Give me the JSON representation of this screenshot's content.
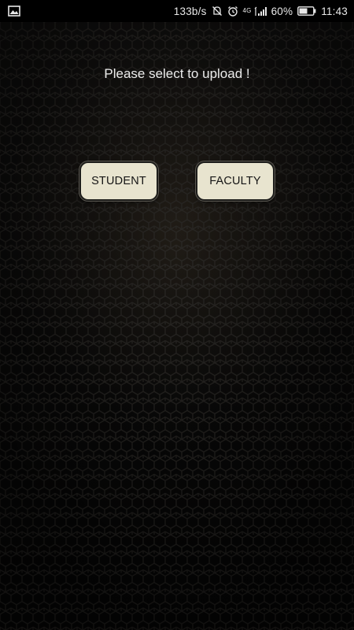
{
  "status_bar": {
    "network_speed": "133b/s",
    "network_type": "4G",
    "battery_percent": "60%",
    "time": "11:43",
    "icons": [
      "image-notification-icon",
      "mute-icon",
      "alarm-icon",
      "signal-icon",
      "battery-icon"
    ]
  },
  "main": {
    "prompt": "Please select to upload !",
    "buttons": {
      "student": "STUDENT",
      "faculty": "FACULTY"
    }
  },
  "theme": {
    "background": "#0c0b0a",
    "button_fill": "#e8e4cf",
    "text_color": "#ececec"
  }
}
